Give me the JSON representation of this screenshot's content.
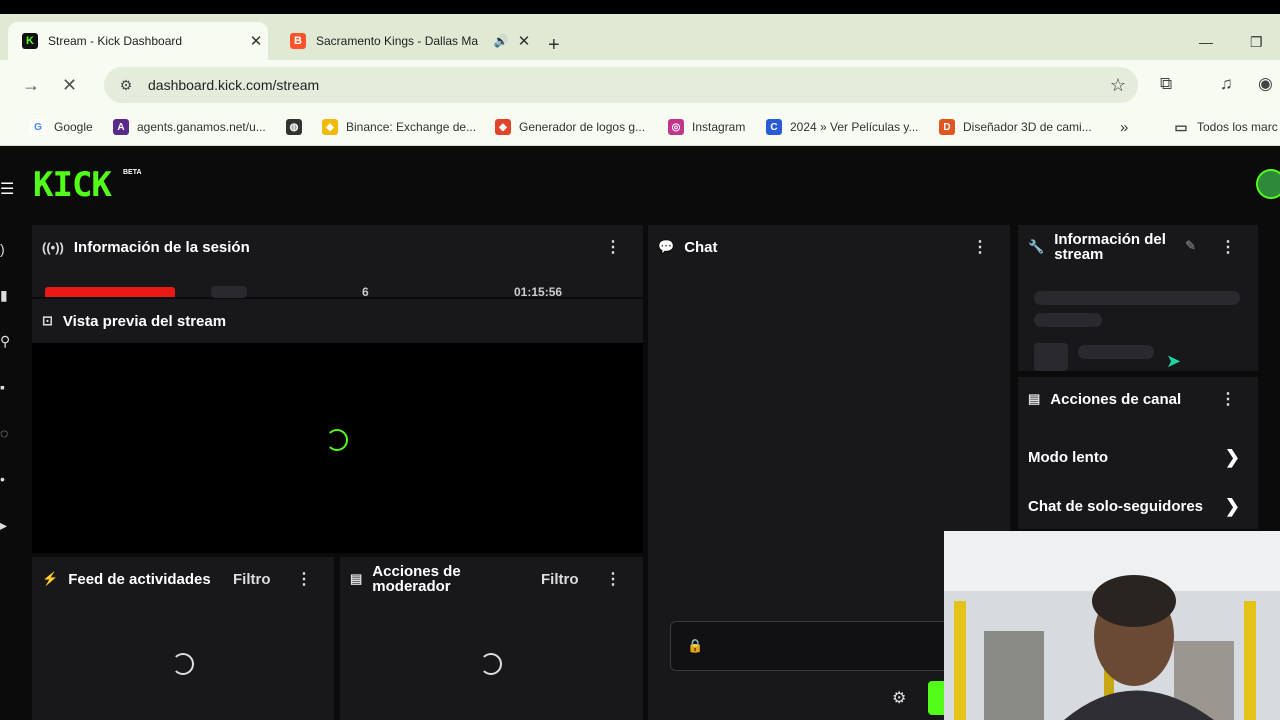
{
  "browser": {
    "tabs": [
      {
        "title": "Stream - Kick Dashboard",
        "active": true,
        "favicon": "kick-icon"
      },
      {
        "title": "Sacramento Kings - Dallas Ma",
        "active": false,
        "favicon": "brave-icon"
      }
    ],
    "url": "dashboard.kick.com/stream",
    "bookmarks": [
      {
        "label": "Google",
        "color": "#4285f4",
        "glyph": "G"
      },
      {
        "label": "agents.ganamos.net/u...",
        "color": "#5a2a8a",
        "glyph": "A"
      },
      {
        "label": "",
        "color": "#333333",
        "glyph": "◍"
      },
      {
        "label": "Binance: Exchange de...",
        "color": "#f0b90b",
        "glyph": "◆"
      },
      {
        "label": "Generador de logos g...",
        "color": "#e0452b",
        "glyph": "◆"
      },
      {
        "label": "Instagram",
        "color": "#c1358a",
        "glyph": "◎"
      },
      {
        "label": "2024 » Ver Películas y...",
        "color": "#2a5bd7",
        "glyph": "C"
      },
      {
        "label": "Diseñador 3D de cami...",
        "color": "#e05520",
        "glyph": "D"
      },
      {
        "label": "Todos los marc",
        "color": "#555555",
        "glyph": "▭"
      }
    ]
  },
  "app": {
    "logo": "KICK",
    "beta": "BETA",
    "accent": "#53fc18"
  },
  "panels": {
    "session_info": {
      "title": "Información de la sesión",
      "stat_1": "6",
      "stat_2": "01:15:56"
    },
    "preview": {
      "title": "Vista previa del stream"
    },
    "chat": {
      "title": "Chat"
    },
    "stream_info": {
      "title": "Información del stream"
    },
    "channel_actions": {
      "title": "Acciones de canal",
      "items": [
        {
          "label": "Modo lento"
        },
        {
          "label": "Chat de solo-seguidores"
        }
      ]
    },
    "activity_feed": {
      "title": "Feed de actividades",
      "filter": "Filtro"
    },
    "mod_actions": {
      "title": "Acciones de moderador",
      "filter": "Filtro"
    }
  }
}
